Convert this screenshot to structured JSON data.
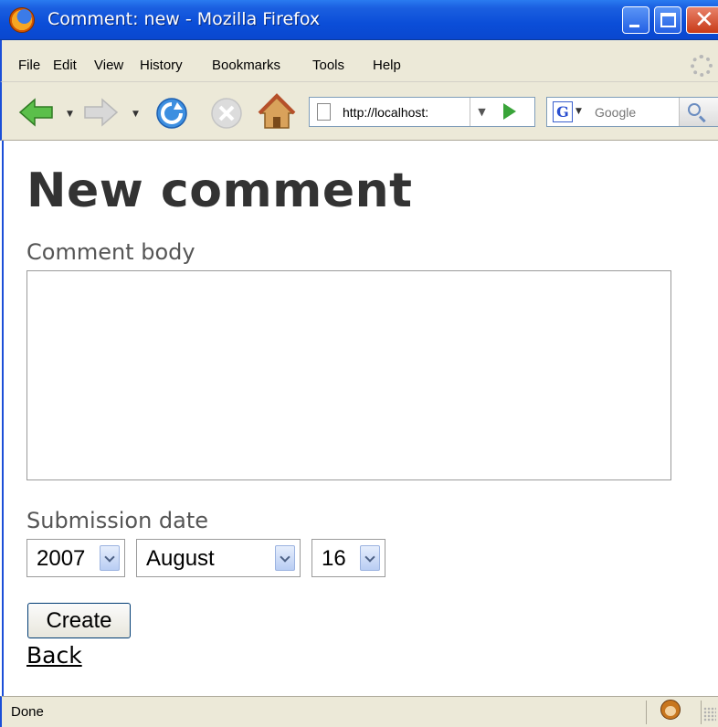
{
  "window": {
    "title": "Comment: new - Mozilla Firefox"
  },
  "menubar": {
    "items": [
      "File",
      "Edit",
      "View",
      "History",
      "Bookmarks",
      "Tools",
      "Help"
    ]
  },
  "toolbar": {
    "back_icon": "arrow-left-icon",
    "forward_icon": "arrow-right-icon",
    "reload_icon": "reload-icon",
    "stop_icon": "stop-icon",
    "home_icon": "home-icon",
    "url": "http://localhost:",
    "search_engine": "G",
    "search_placeholder": "Google"
  },
  "page": {
    "heading": "New comment",
    "comment_body_label": "Comment body",
    "comment_body_value": "",
    "submission_date_label": "Submission date",
    "date": {
      "year": "2007",
      "month": "August",
      "day": "16"
    },
    "create_button": "Create",
    "back_link": "Back"
  },
  "statusbar": {
    "text": "Done"
  },
  "colors": {
    "titlebar": "#0b4ed8",
    "chrome": "#ece9d8",
    "heading": "#333333",
    "label": "#555555",
    "go_arrow": "#39a439",
    "back_arrow": "#5bbf4a"
  }
}
